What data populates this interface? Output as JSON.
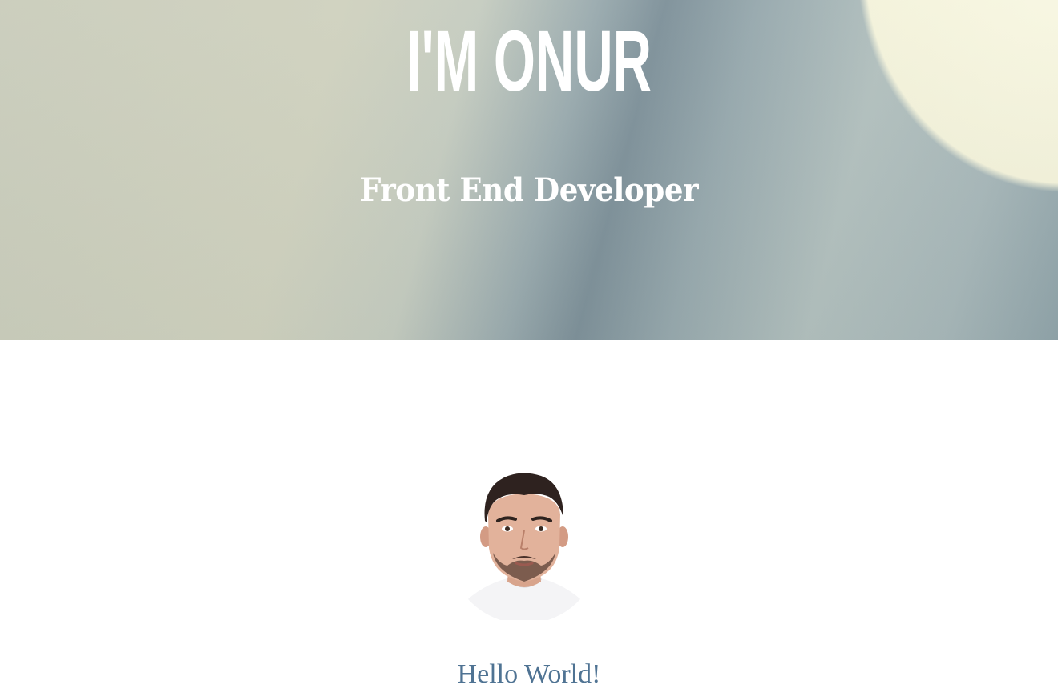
{
  "hero": {
    "title": "I'M ONUR",
    "subtitle": "Front End Developer"
  },
  "profile": {
    "greeting": "Hello World!"
  },
  "colors": {
    "hero_text": "#ffffff",
    "greeting_text": "#4f7393",
    "page_background": "#ffffff"
  }
}
